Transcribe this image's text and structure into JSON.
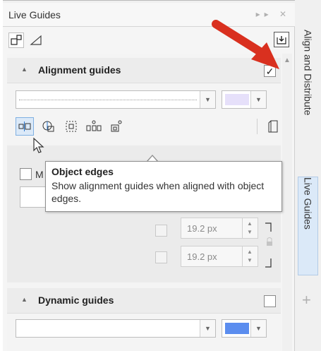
{
  "panel": {
    "title": "Live Guides",
    "title_controls": "▸▸ ✕"
  },
  "alignment": {
    "header": "Alignment guides",
    "enabled": true,
    "color_hex": "#e6e0fa"
  },
  "tooltip": {
    "title": "Object edges",
    "description": "Show alignment guides when aligned with object edges."
  },
  "partial_option": "M",
  "spinners": [
    {
      "value": "19.2 px"
    },
    {
      "value": "19.2 px"
    }
  ],
  "dynamic": {
    "header": "Dynamic guides",
    "enabled": false,
    "color_hex": "#5b8def"
  },
  "right_tabs": {
    "align_distribute": "Align and Distribute",
    "live_guides": "Live Guides"
  },
  "colors": {
    "arrow": "#d9301f",
    "selection": "#dbe9f8"
  }
}
